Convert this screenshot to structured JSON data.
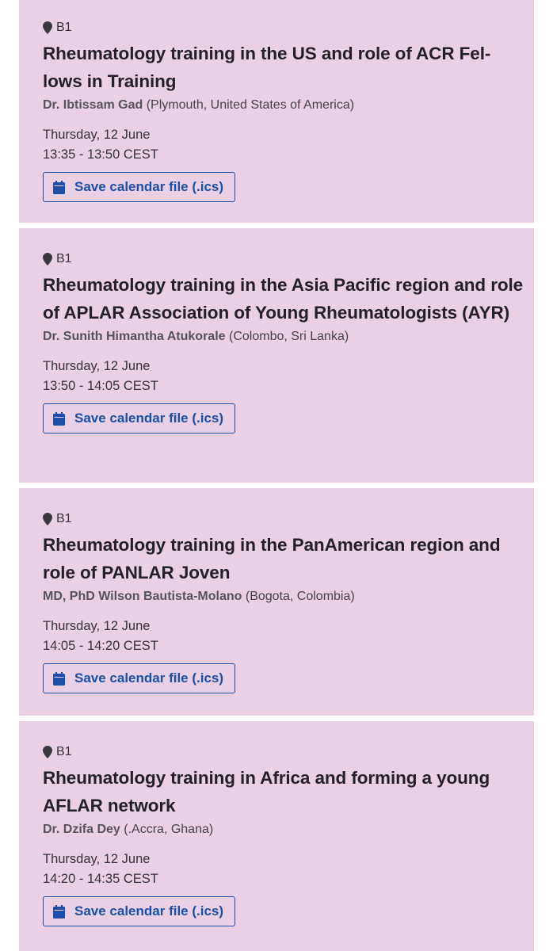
{
  "colors": {
    "card_background": "#e9d0e5",
    "accent": "#1b4fa8",
    "text": "#222226"
  },
  "icons": {
    "location": "map-pin-icon",
    "calendar": "calendar-icon"
  },
  "sessions": [
    {
      "room": "B1",
      "title": "Rheumatology training in the US and role of ACR Fel-lows in Training",
      "speaker_name": "Dr. Ibtissam Gad",
      "speaker_location": "(Plymouth, United States of America)",
      "date": "Thursday, 12 June",
      "time": "13:35 - 13:50 CEST",
      "save_label": "Save calendar file (.ics)"
    },
    {
      "room": "B1",
      "title": "Rheumatology training in the Asia Pacific region and role of APLAR Association of Young Rheumatologists (AYR)",
      "speaker_name": "Dr. Sunith Himantha Atukorale",
      "speaker_location": "(Colombo, Sri Lanka)",
      "date": "Thursday, 12 June",
      "time": "13:50 - 14:05 CEST",
      "save_label": "Save calendar file (.ics)"
    },
    {
      "room": "B1",
      "title": "Rheumatology training in the PanAmerican region and role of PANLAR Joven",
      "speaker_name": "MD, PhD Wilson Bautista-Molano",
      "speaker_location": "(Bogota, Colombia)",
      "date": "Thursday, 12 June",
      "time": "14:05 - 14:20 CEST",
      "save_label": "Save calendar file (.ics)"
    },
    {
      "room": "B1",
      "title": "Rheumatology training in Africa and forming a young AFLAR network",
      "speaker_name": "Dr. Dzifa Dey",
      "speaker_location": "(.Accra, Ghana)",
      "date": "Thursday, 12 June",
      "time": "14:20 - 14:35 CEST",
      "save_label": "Save calendar file (.ics)"
    }
  ]
}
